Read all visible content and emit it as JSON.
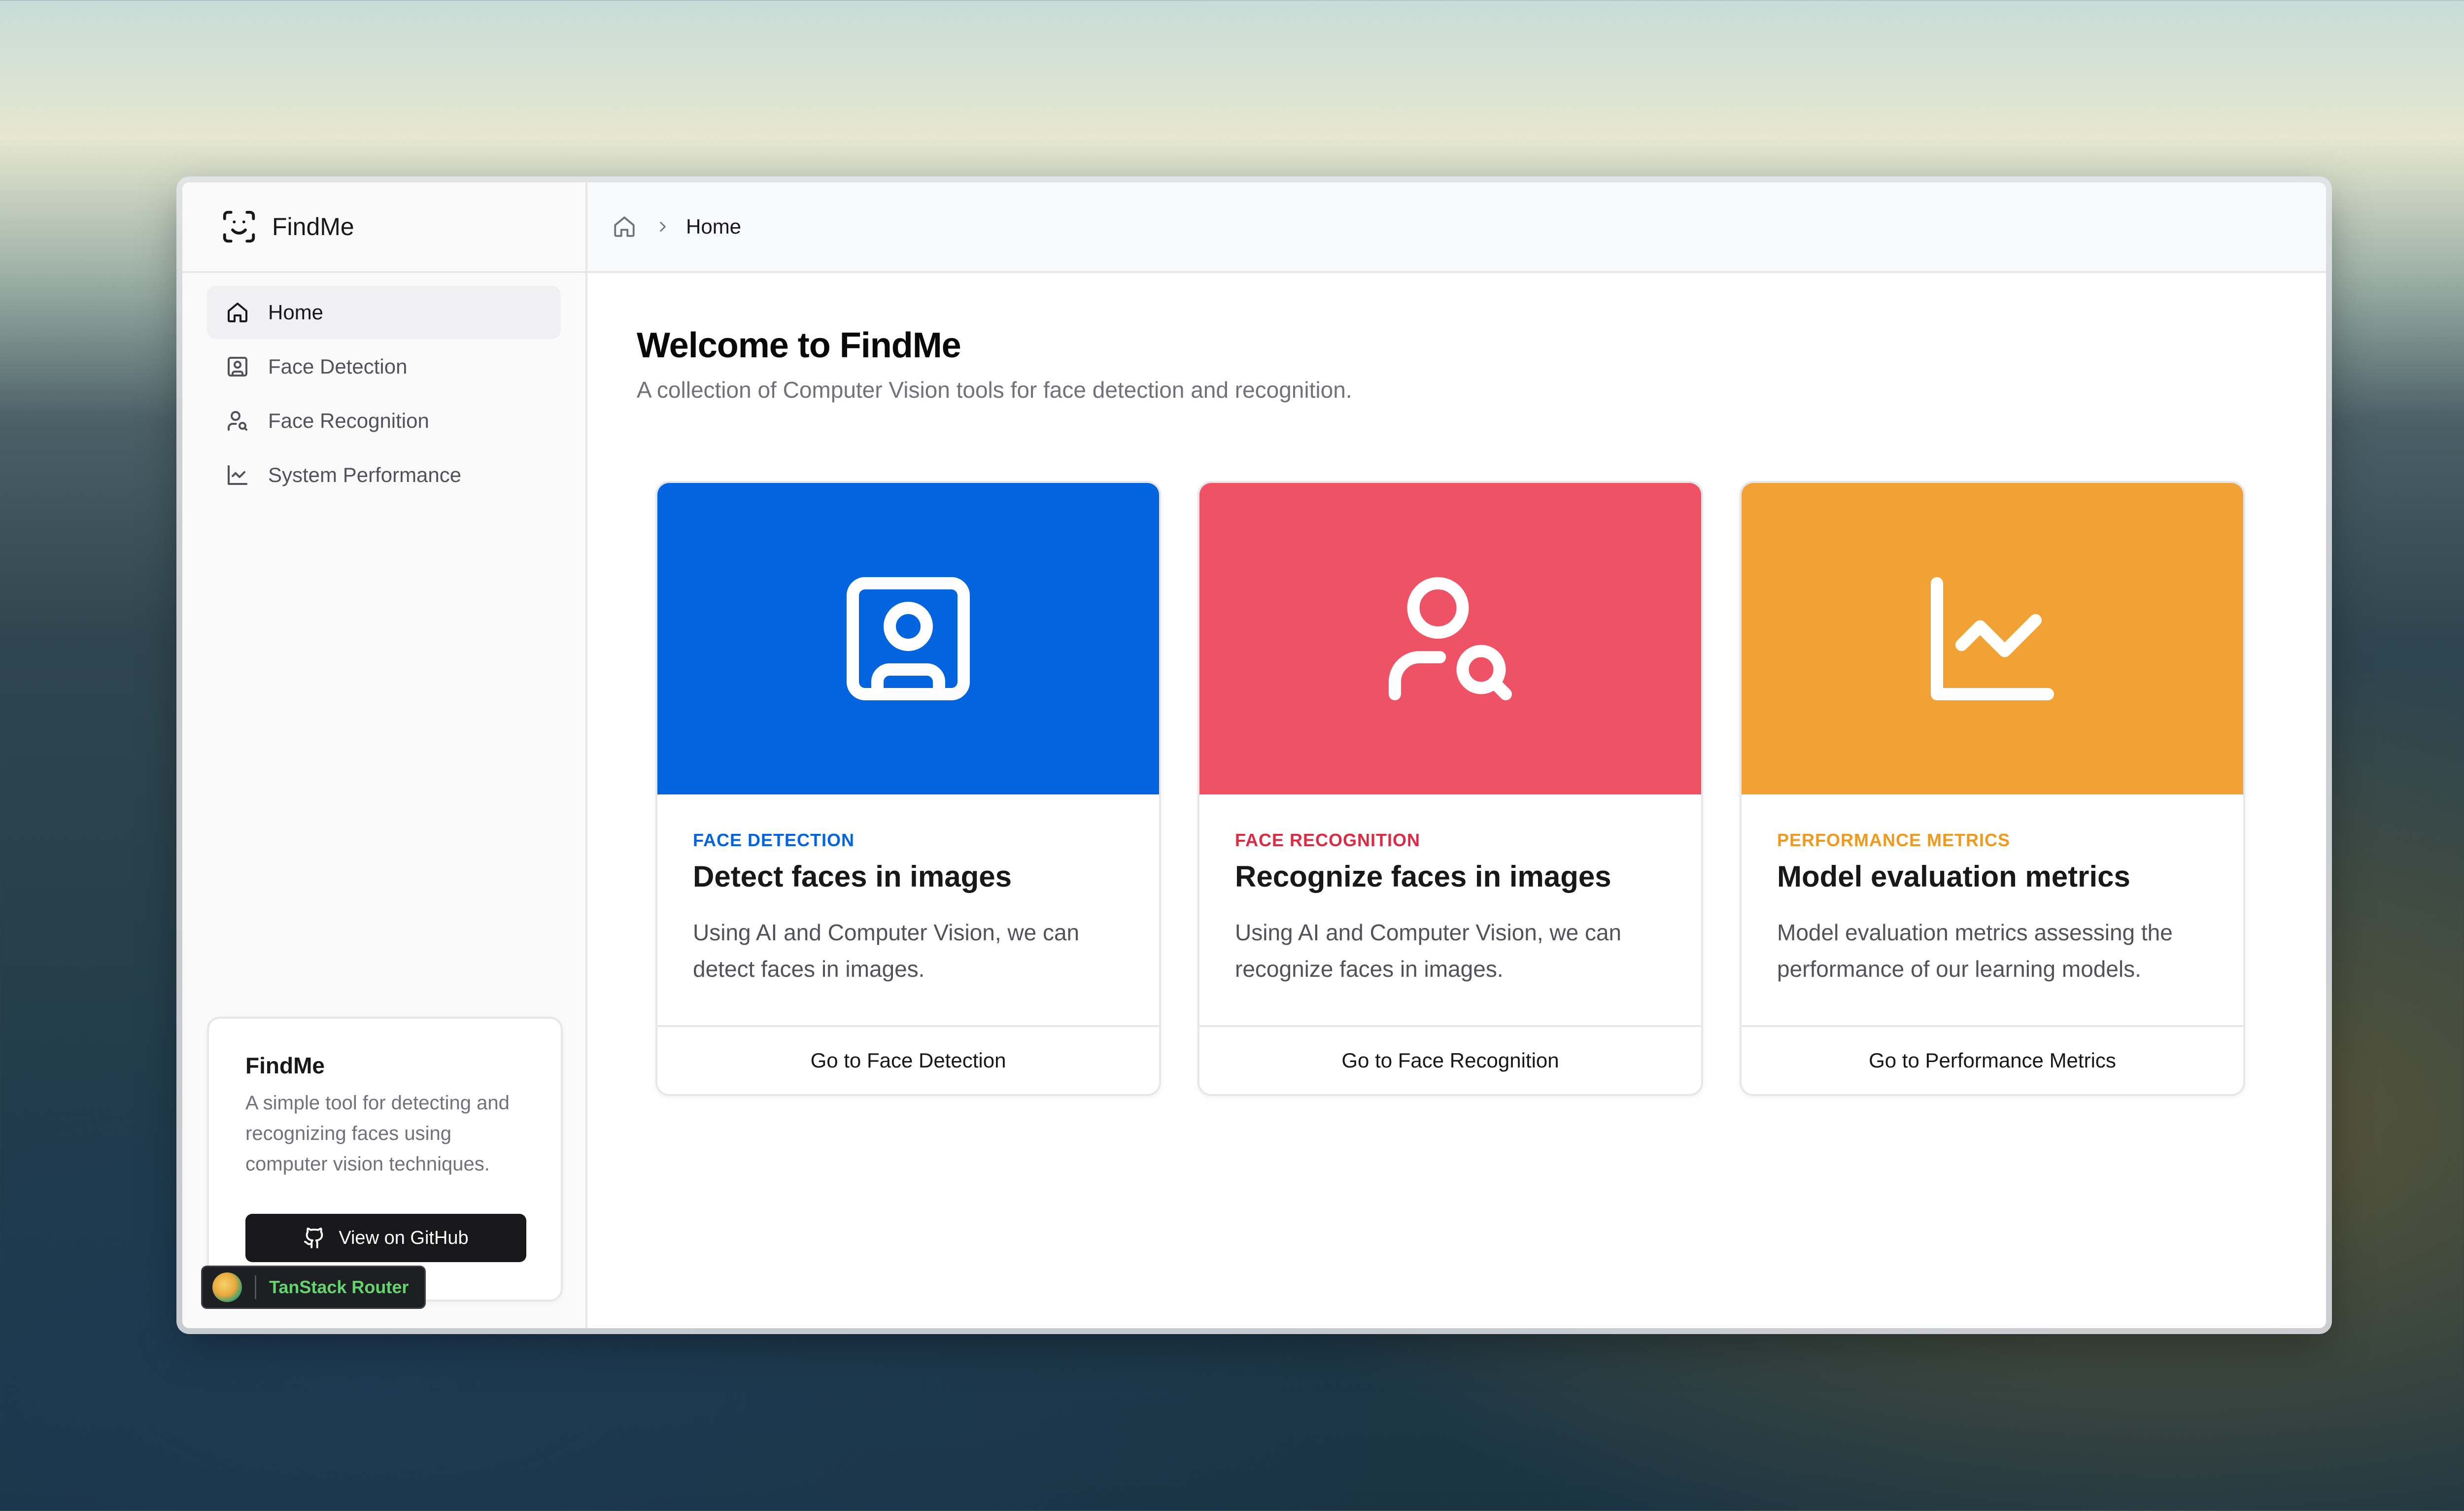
{
  "app": {
    "name": "FindMe"
  },
  "sidebar": {
    "items": [
      {
        "label": "Home",
        "icon": "home-icon",
        "active": true
      },
      {
        "label": "Face Detection",
        "icon": "face-detection-icon",
        "active": false
      },
      {
        "label": "Face Recognition",
        "icon": "face-recognition-icon",
        "active": false
      },
      {
        "label": "System Performance",
        "icon": "chart-icon",
        "active": false
      }
    ],
    "info_card": {
      "title": "FindMe",
      "description": "A simple tool for detecting and recognizing faces using computer vision techniques.",
      "button_label": "View on GitHub"
    }
  },
  "devtools_badge": {
    "label": "TanStack Router"
  },
  "breadcrumb": {
    "current": "Home"
  },
  "main": {
    "title": "Welcome to FindMe",
    "subtitle": "A collection of Computer Vision tools for face detection and recognition."
  },
  "cards": [
    {
      "tag": "FACE DETECTION",
      "title": "Detect faces in images",
      "description": "Using AI and Computer Vision, we can detect faces in images.",
      "link": "Go to Face Detection",
      "color": "#0364e0",
      "tag_color": "#0364e0",
      "icon": "face-detection-icon"
    },
    {
      "tag": "FACE RECOGNITION",
      "title": "Recognize faces in images",
      "description": "Using AI and Computer Vision, we can recognize faces in images.",
      "link": "Go to Face Recognition",
      "color": "#ee5264",
      "tag_color": "#dc2a43",
      "icon": "face-recognition-icon"
    },
    {
      "tag": "PERFORMANCE METRICS",
      "title": "Model evaluation metrics",
      "description": "Model evaluation metrics assessing the performance of our learning models.",
      "link": "Go to Performance Metrics",
      "color": "#f2a234",
      "tag_color": "#ef9a1e",
      "icon": "chart-icon"
    }
  ]
}
